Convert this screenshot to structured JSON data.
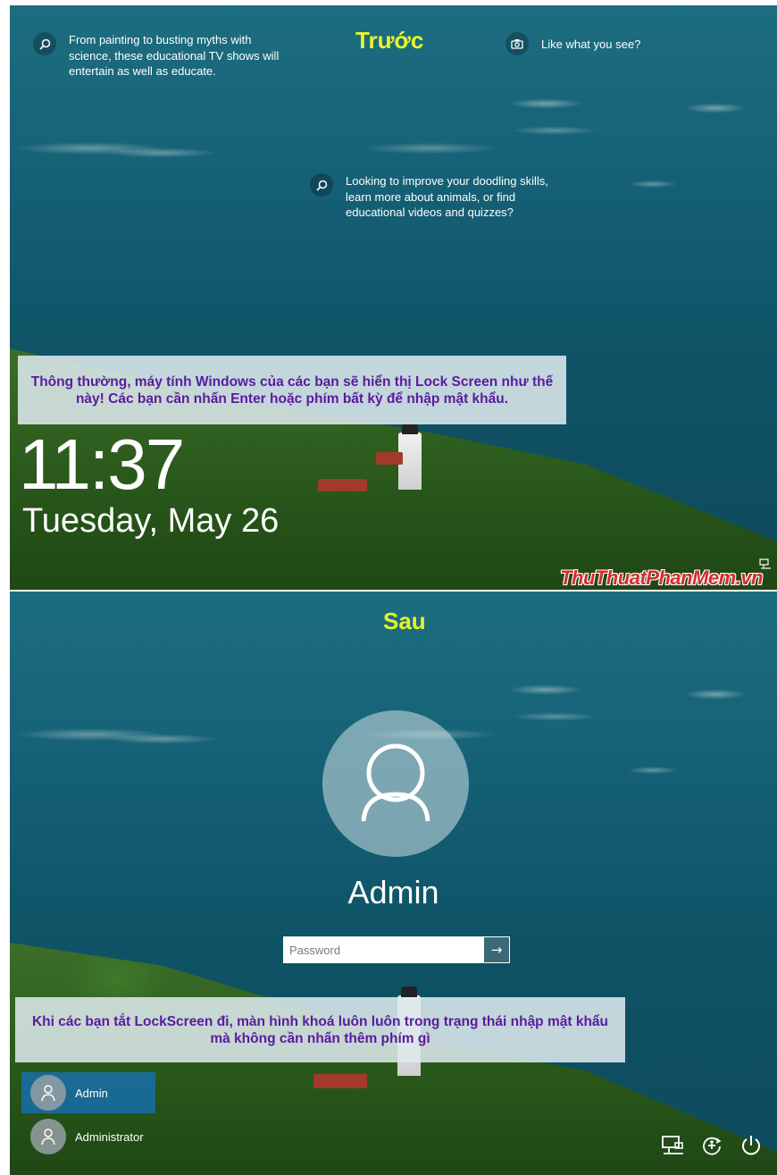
{
  "top": {
    "heading": "Trước",
    "tips": [
      {
        "icon": "search-icon",
        "text": "From painting to busting myths with science, these educational TV shows will entertain as well as educate."
      },
      {
        "icon": "camera-icon",
        "text": "Like what you see?"
      },
      {
        "icon": "search-icon",
        "text": "Looking to improve your doodling skills, learn more about animals, or find educational videos and quizzes?"
      }
    ],
    "note": "Thông thường, máy tính Windows của các bạn sẽ hiển thị Lock Screen như thế này! Các bạn cần nhấn Enter hoặc phím bất kỳ để nhập mật khẩu.",
    "time": "11:37",
    "date": "Tuesday, May 26",
    "watermark": "ThuThuatPhanMem.vn",
    "network_icon": "network-icon"
  },
  "bottom": {
    "heading": "Sau",
    "username": "Admin",
    "password_placeholder": "Password",
    "note": "Khi các bạn tắt LockScreen đi, màn hình khoá luôn luôn trong trạng thái nhập mật khẩu mà không cần nhấn thêm phím gì",
    "users": [
      {
        "name": "Admin",
        "selected": true
      },
      {
        "name": "Administrator",
        "selected": false
      }
    ],
    "system_icons": [
      "network-icon",
      "accessibility-icon",
      "power-icon"
    ]
  },
  "colors": {
    "heading": "#e6f52b",
    "note_text": "#5b1aa0",
    "selected_user": "#166eaa",
    "watermark": "#d22d2d"
  }
}
